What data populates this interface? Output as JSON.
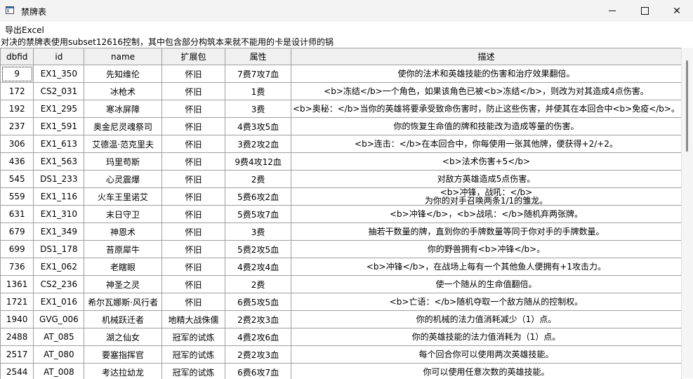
{
  "window": {
    "title": "禁牌表"
  },
  "menu": {
    "export": "导出Excel"
  },
  "info_text": "对决的禁牌表使用subset12616控制，其中包含部分构筑本来就不能用的卡是设计师的锅",
  "columns": [
    "dbfid",
    "id",
    "name",
    "扩展包",
    "属性",
    "描述"
  ],
  "rows": [
    [
      "9",
      "EX1_350",
      "先知维伦",
      "怀旧",
      "7费7攻7血",
      "使你的法术和英雄技能的伤害和治疗效果翻倍。"
    ],
    [
      "172",
      "CS2_031",
      "冰枪术",
      "怀旧",
      "1费",
      "<b>冻结</b>一个角色，如果该角色已被<b>冻结</b>，则改为对其造成4点伤害。"
    ],
    [
      "192",
      "EX1_295",
      "寒冰屏障",
      "怀旧",
      "3费",
      "<b>奥秘：</b>当你的英雄将要承受致命伤害时，防止这些伤害，并使其在本回合中<b>免疫</b>。"
    ],
    [
      "237",
      "EX1_591",
      "奥金尼灵魂祭司",
      "怀旧",
      "4费3攻5血",
      "你的恢复生命值的牌和技能改为造成等量的伤害。"
    ],
    [
      "306",
      "EX1_613",
      "艾德温·范克里夫",
      "怀旧",
      "3费2攻2血",
      "<b>连击：</b>在本回合中，你每使用一张其他牌，便获得+2/+2。"
    ],
    [
      "436",
      "EX1_563",
      "玛里苟斯",
      "怀旧",
      "9费4攻12血",
      "<b>法术伤害+5</b>"
    ],
    [
      "545",
      "DS1_233",
      "心灵震爆",
      "怀旧",
      "2费",
      "对敌方英雄造成5点伤害。"
    ],
    [
      "559",
      "EX1_116",
      "火车王里诺艾",
      "怀旧",
      "5费6攻2血",
      "<b>冲锋，战吼：</b>\n为你的对手召唤两条1/1的雏龙。"
    ],
    [
      "631",
      "EX1_310",
      "末日守卫",
      "怀旧",
      "5费5攻7血",
      "<b>冲锋</b>，<b>战吼：</b>随机弃两张牌。"
    ],
    [
      "679",
      "EX1_349",
      "神恩术",
      "怀旧",
      "3费",
      "抽若干数量的牌，直到你的手牌数量等同于你对手的手牌数量。"
    ],
    [
      "699",
      "DS1_178",
      "苔原犀牛",
      "怀旧",
      "5费2攻5血",
      "你的野兽拥有<b>冲锋</b>。"
    ],
    [
      "736",
      "EX1_062",
      "老瞎眼",
      "怀旧",
      "4费2攻4血",
      "<b>冲锋</b>，在战场上每有一个其他鱼人便拥有+1攻击力。"
    ],
    [
      "1361",
      "CS2_236",
      "神圣之灵",
      "怀旧",
      "2费",
      "使一个随从的生命值翻倍。"
    ],
    [
      "1721",
      "EX1_016",
      "希尔瓦娜斯·风行者",
      "怀旧",
      "6费5攻5血",
      "<b>亡语：</b>随机夺取一个敌方随从的控制权。"
    ],
    [
      "1940",
      "GVG_006",
      "机械跃迁者",
      "地精大战侏儒",
      "2费2攻3血",
      "你的机械的法力值消耗减少（1）点。"
    ],
    [
      "2488",
      "AT_085",
      "湖之仙女",
      "冠军的试炼",
      "4费2攻6血",
      "你的英雄技能的法力值消耗为（1）点。"
    ],
    [
      "2517",
      "AT_080",
      "要塞指挥官",
      "冠军的试炼",
      "2费2攻3血",
      "每个回合你可以使用两次英雄技能。"
    ],
    [
      "2544",
      "AT_008",
      "考达拉幼龙",
      "冠军的试炼",
      "6费6攻7血",
      "你可以使用任意次数的英雄技能。"
    ]
  ]
}
